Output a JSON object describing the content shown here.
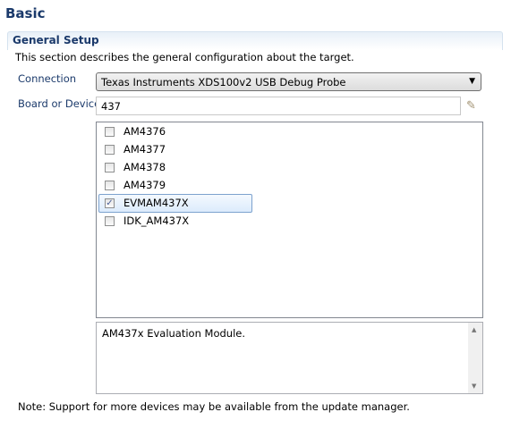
{
  "title": "Basic",
  "section": {
    "title": "General Setup",
    "description": "This section describes the general configuration about the target."
  },
  "connection": {
    "label": "Connection",
    "value": "Texas Instruments XDS100v2 USB Debug Probe"
  },
  "board": {
    "label": "Board or Device",
    "value": "437"
  },
  "devices": [
    {
      "label": "AM4376",
      "checked": false
    },
    {
      "label": "AM4377",
      "checked": false
    },
    {
      "label": "AM4378",
      "checked": false
    },
    {
      "label": "AM4379",
      "checked": false
    },
    {
      "label": "EVMAM437X",
      "checked": true
    },
    {
      "label": "IDK_AM437X",
      "checked": false
    }
  ],
  "info": "AM437x Evaluation Module.",
  "note": "Note: Support for more devices may be available from the update manager."
}
